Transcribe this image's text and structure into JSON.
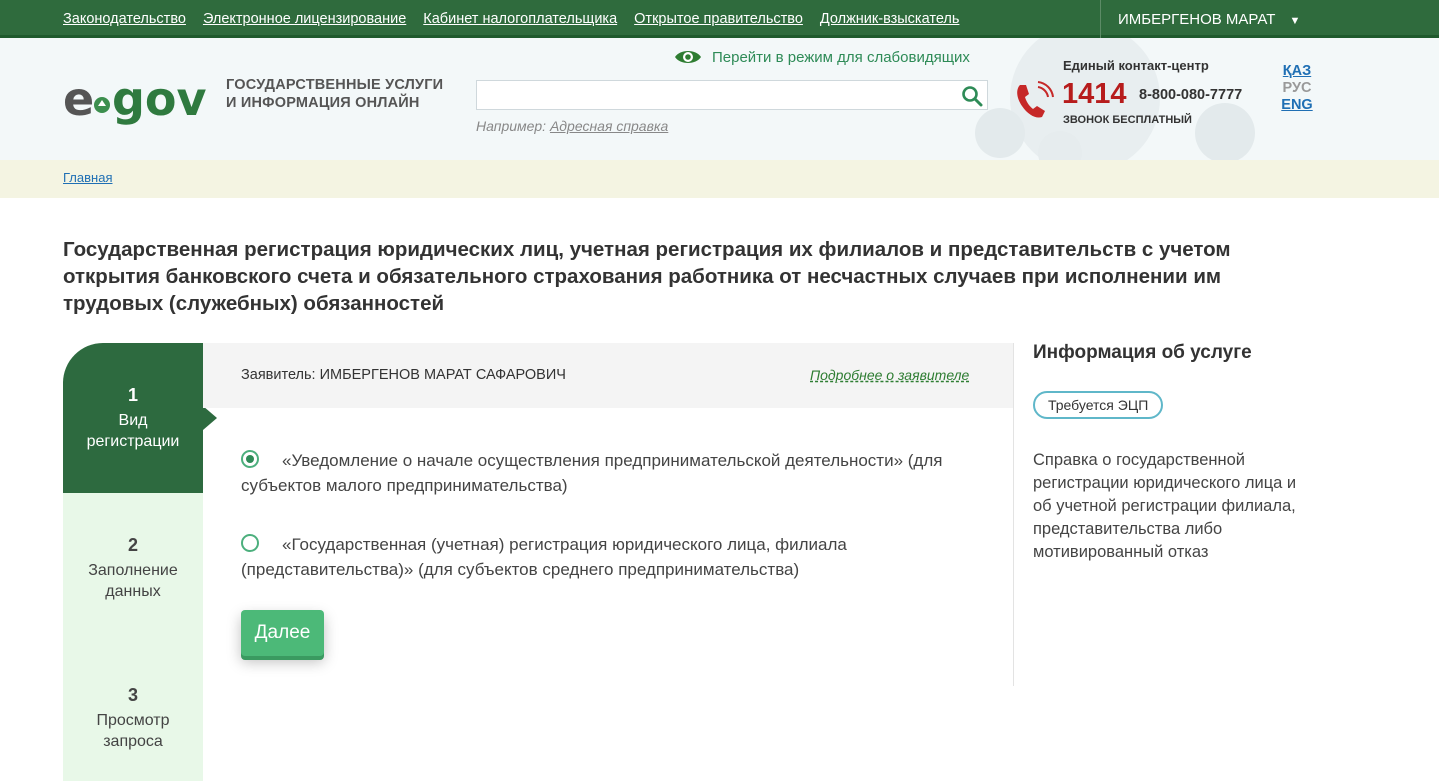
{
  "topnav": {
    "links": [
      "Законодательство",
      "Электронное лицензирование",
      "Кабинет налогоплательщика",
      "Открытое правительство",
      "Должник-взыскатель"
    ],
    "user_name": "ИМБЕРГЕНОВ МАРАТ"
  },
  "header": {
    "logo_text": "egov",
    "tagline_line1": "ГОСУДАРСТВЕННЫЕ УСЛУГИ",
    "tagline_line2": "И ИНФОРМАЦИЯ ОНЛАЙН",
    "blind_mode_link": "Перейти в режим для слабовидящих",
    "search": {
      "value": "",
      "hint_prefix": "Например:",
      "hint_link": "Адресная справка"
    },
    "contact": {
      "title": "Единый контакт-центр",
      "number": "1414",
      "alt_number": "8-800-080-7777",
      "note": "ЗВОНОК БЕСПЛАТНЫЙ"
    },
    "languages": [
      {
        "code": "ҚАЗ",
        "active": false
      },
      {
        "code": "РУС",
        "active": true
      },
      {
        "code": "ENG",
        "active": false
      }
    ]
  },
  "breadcrumb": {
    "home": "Главная"
  },
  "page": {
    "title": "Государственная регистрация юридических лиц, учетная регистрация их филиалов и представительств с учетом открытия банковского счета и обязательного страхования работника от несчастных случаев при исполнении им трудовых (служебных) обязанностей"
  },
  "steps": [
    {
      "num": "1",
      "label_line1": "Вид",
      "label_line2": "регистрации",
      "active": true
    },
    {
      "num": "2",
      "label_line1": "Заполнение",
      "label_line2": "данных",
      "active": false
    },
    {
      "num": "3",
      "label_line1": "Просмотр",
      "label_line2": "запроса",
      "active": false
    }
  ],
  "form": {
    "applicant_label": "Заявитель: ИМБЕРГЕНОВ МАРАТ САФАРОВИЧ",
    "applicant_more": "Подробнее о заявителе",
    "options": [
      {
        "text": "«Уведомление о начале осуществления предпринимательской деятельности» (для субъектов малого предпринимательства)",
        "checked": true
      },
      {
        "text": "«Государственная (учетная) регистрация юридического лица, филиала (представительства)» (для субъектов среднего предпринимательства)",
        "checked": false
      }
    ],
    "next_button": "Далее"
  },
  "info": {
    "title": "Информация об услуге",
    "badge": "Требуется ЭЦП",
    "description": "Справка о государственной регистрации юридического лица и об учетной регистрации филиала, представительства либо мотивированный отказ"
  },
  "colors": {
    "topbar": "#2f6b3d",
    "accent_green": "#2e8b57",
    "button": "#4cb978",
    "contact_number": "#b71c1c",
    "link_blue": "#1f6fb4"
  },
  "icons": [
    "eye-icon",
    "search-icon",
    "phone-icon",
    "caret-down-icon"
  ]
}
